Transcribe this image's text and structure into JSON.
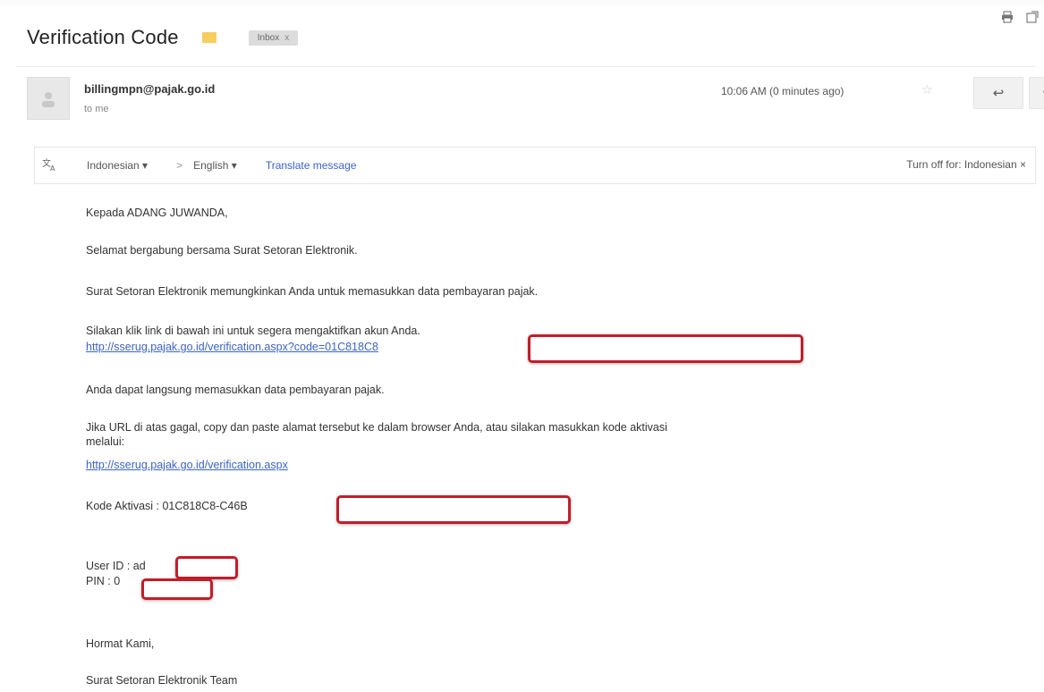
{
  "header": {
    "subject": "Verification Code",
    "label": "Inbox",
    "label_close": "x",
    "print_icon": "print-icon",
    "open_new_window_icon": "open-in-new-icon"
  },
  "sender": {
    "email": "billingmpn@pajak.go.id",
    "to": "to me",
    "time": "10:06 AM (0 minutes ago)",
    "reply_glyph": "↩",
    "more_glyph": "▾"
  },
  "translate": {
    "from_lang": "Indonesian ▾",
    "arrow": ">",
    "to_lang": "English ▾",
    "action": "Translate message",
    "turn_off": "Turn off for: Indonesian ×"
  },
  "message": {
    "greeting": "Kepada ADANG JUWANDA,",
    "line1": "Selamat bergabung bersama Surat Setoran Elektronik.",
    "line2": "Surat Setoran Elektronik memungkinkan Anda untuk memasukkan data pembayaran pajak.",
    "line3": "Silakan klik link di bawah ini untuk segera mengaktifkan akun Anda.",
    "verify_link": "http://sserug.pajak.go.id/verification.aspx?code=01C818C8",
    "line4": "Anda dapat langsung memasukkan data pembayaran pajak.",
    "line5a": "Jika URL di atas gagal, copy dan paste alamat tersebut ke dalam browser Anda, atau silakan masukkan kode aktivasi",
    "line5b": "melalui:",
    "verify_link_plain": "http://sserug.pajak.go.id/verification.aspx",
    "activation": "Kode Aktivasi : 01C818C8-C46B",
    "user_id": "User ID : ad",
    "pin": "PIN : 0",
    "regards": "Hormat Kami,",
    "team": "Surat Setoran Elektronik Team"
  },
  "colors": {
    "link": "#3b63c4",
    "redaction": "#c21d2a",
    "importance": "#f4c542"
  }
}
